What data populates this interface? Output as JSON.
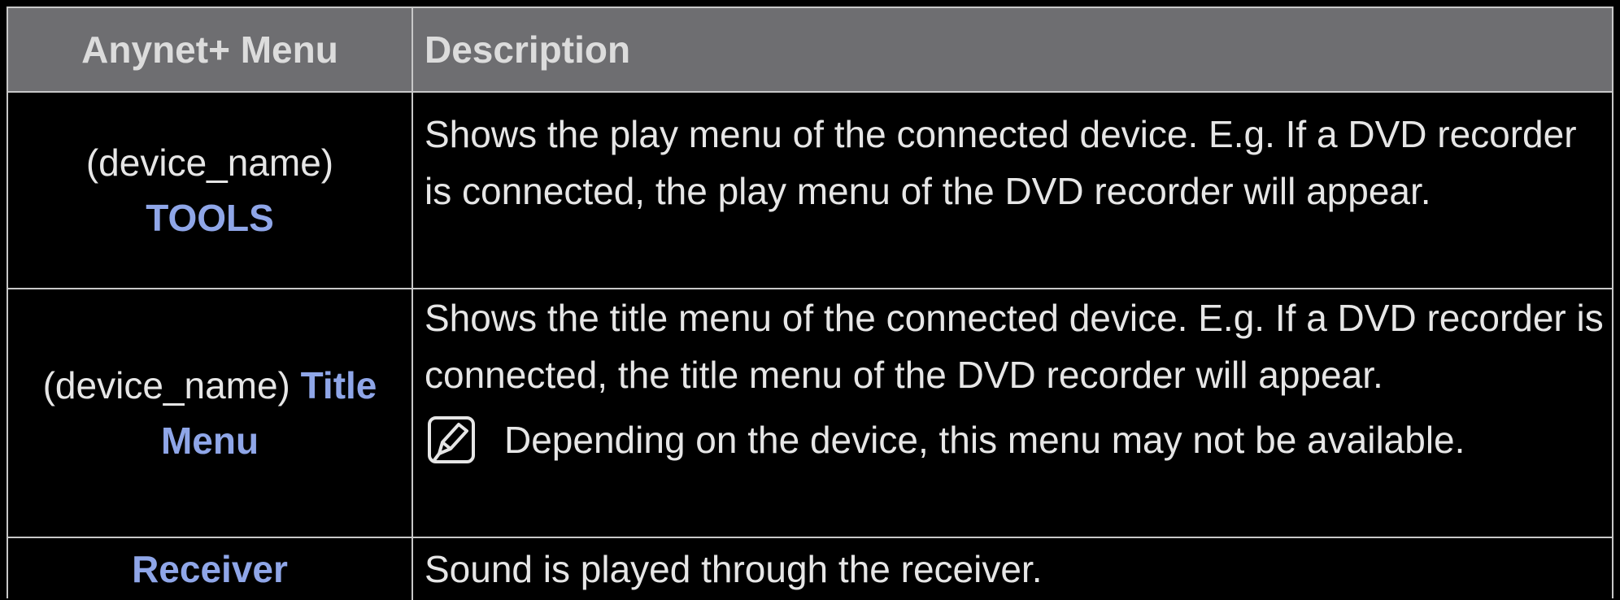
{
  "table": {
    "headers": [
      "Anynet+ Menu",
      "Description"
    ],
    "rows": [
      {
        "menu_prefix": "(device_name)",
        "menu_highlight": "TOOLS",
        "description": "Shows the play menu of the connected device. E.g. If a DVD recorder is connected, the play menu of the DVD recorder will appear."
      },
      {
        "menu_prefix": "(device_name)",
        "menu_highlight": "Title Menu",
        "description": "Shows the title menu of the connected device. E.g. If a DVD recorder is connected, the title menu of the DVD recorder will appear.",
        "note": "Depending on the device, this menu may not be available.",
        "note_icon": "note-icon"
      },
      {
        "menu_prefix": "",
        "menu_highlight": "Receiver",
        "description": "Sound is played through the receiver."
      }
    ]
  },
  "colors": {
    "header_bg": "#6e6e71",
    "highlight": "#8fa6e8",
    "background": "#000000",
    "text": "#e6e6e6"
  }
}
